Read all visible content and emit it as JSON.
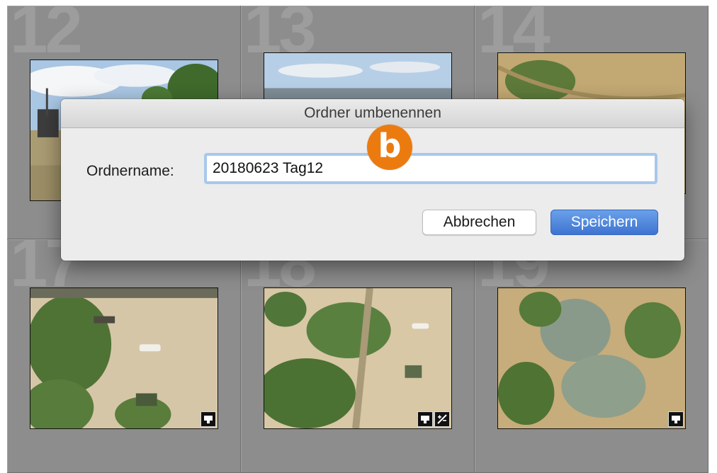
{
  "grid": {
    "cells": [
      {
        "number": "12",
        "badges": []
      },
      {
        "number": "13",
        "badges": []
      },
      {
        "number": "14",
        "badges": []
      },
      {
        "number": "17",
        "badges": [
          "comment-icon"
        ]
      },
      {
        "number": "18",
        "badges": [
          "comment-icon",
          "develop-adjust-icon"
        ]
      },
      {
        "number": "19",
        "badges": [
          "comment-icon"
        ]
      }
    ]
  },
  "dialog": {
    "title": "Ordner umbenennen",
    "field_label": "Ordnername:",
    "field_value": "20180623 Tag12",
    "cancel_label": "Abbrechen",
    "save_label": "Speichern"
  },
  "callout": {
    "label": "b",
    "color": "#ec7b0f"
  },
  "colors": {
    "accent": "#3e74d0",
    "focus_ring": "#a8c8ec"
  }
}
